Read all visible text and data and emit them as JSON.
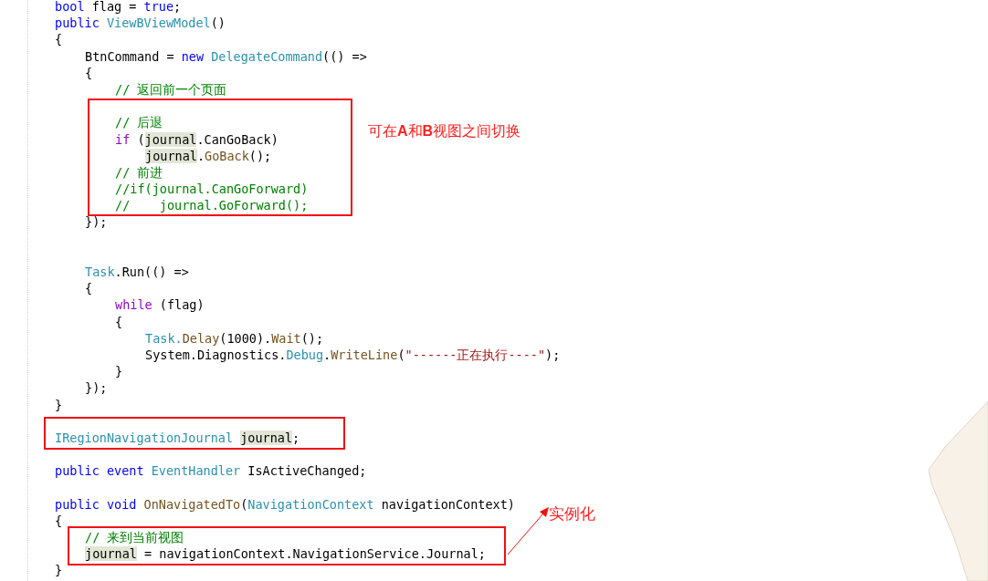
{
  "code_lines": [
    {
      "kind": "member",
      "tokens": [
        {
          "kind": "keyword",
          "text": "bool"
        },
        {
          "kind": "plain",
          "text": " flag = "
        },
        {
          "kind": "keyword",
          "text": "true"
        },
        {
          "kind": "plain",
          "text": ";"
        }
      ]
    },
    {
      "kind": "member",
      "tokens": [
        {
          "kind": "keyword",
          "text": "public "
        },
        {
          "kind": "type",
          "text": "ViewBViewModel"
        },
        {
          "kind": "plain",
          "text": "()"
        }
      ]
    },
    {
      "kind": "member",
      "tokens": [
        {
          "kind": "plain",
          "text": "{"
        }
      ]
    },
    {
      "kind": "statement",
      "tokens": [
        {
          "kind": "plain",
          "text": "BtnCommand = "
        },
        {
          "kind": "keyword",
          "text": "new "
        },
        {
          "kind": "type",
          "text": "DelegateCommand"
        },
        {
          "kind": "plain",
          "text": "(() =>"
        }
      ]
    },
    {
      "kind": "statement",
      "tokens": [
        {
          "kind": "plain",
          "text": "{"
        }
      ]
    },
    {
      "kind": "inner",
      "tokens": [
        {
          "kind": "comment",
          "text": "// 返回前一个页面"
        }
      ]
    },
    {
      "kind": "blank"
    },
    {
      "kind": "inner",
      "tokens": [
        {
          "kind": "comment",
          "text": "// 后退"
        }
      ]
    },
    {
      "kind": "inner",
      "tokens": [
        {
          "kind": "control",
          "text": "if"
        },
        {
          "kind": "plain",
          "text": " ("
        },
        {
          "kind": "highlight",
          "text": "journal"
        },
        {
          "kind": "plain",
          "text": ".CanGoBack)"
        }
      ]
    },
    {
      "kind": "nested",
      "tokens": [
        {
          "kind": "highlight",
          "text": "journal"
        },
        {
          "kind": "plain",
          "text": "."
        },
        {
          "kind": "method",
          "text": "GoBack"
        },
        {
          "kind": "plain",
          "text": "();"
        }
      ]
    },
    {
      "kind": "inner",
      "tokens": [
        {
          "kind": "comment",
          "text": "// 前进"
        }
      ]
    },
    {
      "kind": "inner",
      "tokens": [
        {
          "kind": "comment",
          "text": "//if(journal.CanGoForward)"
        }
      ]
    },
    {
      "kind": "inner",
      "tokens": [
        {
          "kind": "comment",
          "text": "//    journal.GoForward();"
        }
      ]
    },
    {
      "kind": "statement",
      "tokens": [
        {
          "kind": "plain",
          "text": "});"
        }
      ]
    },
    {
      "kind": "blank"
    },
    {
      "kind": "blank"
    },
    {
      "kind": "statement",
      "tokens": [
        {
          "kind": "type",
          "text": "Task"
        },
        {
          "kind": "plain",
          "text": ".Run(() =>"
        }
      ]
    },
    {
      "kind": "statement",
      "tokens": [
        {
          "kind": "plain",
          "text": "{"
        }
      ]
    },
    {
      "kind": "inner",
      "tokens": [
        {
          "kind": "control",
          "text": "while"
        },
        {
          "kind": "plain",
          "text": " (flag)"
        }
      ]
    },
    {
      "kind": "inner",
      "tokens": [
        {
          "kind": "plain",
          "text": "{"
        }
      ]
    },
    {
      "kind": "nested",
      "tokens": [
        {
          "kind": "type",
          "text": "Task."
        },
        {
          "kind": "method",
          "text": "Delay"
        },
        {
          "kind": "plain",
          "text": "(1000)."
        },
        {
          "kind": "method",
          "text": "Wait"
        },
        {
          "kind": "plain",
          "text": "();"
        }
      ]
    },
    {
      "kind": "nested",
      "tokens": [
        {
          "kind": "plain",
          "text": "System.Diagnostics."
        },
        {
          "kind": "type",
          "text": "Debug"
        },
        {
          "kind": "plain",
          "text": "."
        },
        {
          "kind": "method",
          "text": "WriteLine"
        },
        {
          "kind": "plain",
          "text": "("
        },
        {
          "kind": "string",
          "text": "\"------正在执行----\""
        },
        {
          "kind": "plain",
          "text": ");"
        }
      ]
    },
    {
      "kind": "inner",
      "tokens": [
        {
          "kind": "plain",
          "text": "}"
        }
      ]
    },
    {
      "kind": "statement",
      "tokens": [
        {
          "kind": "plain",
          "text": "});"
        }
      ]
    },
    {
      "kind": "member",
      "tokens": [
        {
          "kind": "plain",
          "text": "}"
        }
      ]
    },
    {
      "kind": "blank"
    },
    {
      "kind": "member",
      "tokens": [
        {
          "kind": "type",
          "text": "IRegionNavigationJournal "
        },
        {
          "kind": "highlight",
          "text": "journal"
        },
        {
          "kind": "plain",
          "text": ";"
        }
      ]
    },
    {
      "kind": "blank"
    },
    {
      "kind": "member",
      "tokens": [
        {
          "kind": "keyword",
          "text": "public event "
        },
        {
          "kind": "type",
          "text": "EventHandler"
        },
        {
          "kind": "plain",
          "text": " IsActiveChanged;"
        }
      ]
    },
    {
      "kind": "blank"
    },
    {
      "kind": "member",
      "tokens": [
        {
          "kind": "keyword",
          "text": "public void "
        },
        {
          "kind": "method",
          "text": "OnNavigatedTo"
        },
        {
          "kind": "plain",
          "text": "("
        },
        {
          "kind": "type",
          "text": "NavigationContext"
        },
        {
          "kind": "plain",
          "text": " navigationContext)"
        }
      ]
    },
    {
      "kind": "member",
      "tokens": [
        {
          "kind": "plain",
          "text": "{"
        }
      ]
    },
    {
      "kind": "statement",
      "tokens": [
        {
          "kind": "comment",
          "text": "// 来到当前视图"
        }
      ]
    },
    {
      "kind": "statement",
      "tokens": [
        {
          "kind": "highlight",
          "text": "journal"
        },
        {
          "kind": "plain",
          "text": " = navigationContext.NavigationService.Journal;"
        }
      ]
    },
    {
      "kind": "member",
      "tokens": [
        {
          "kind": "plain",
          "text": "}"
        }
      ]
    }
  ],
  "annotations": {
    "switch_note": "可在**A**和**B**视图之间切换",
    "instance_note": "实例化"
  }
}
